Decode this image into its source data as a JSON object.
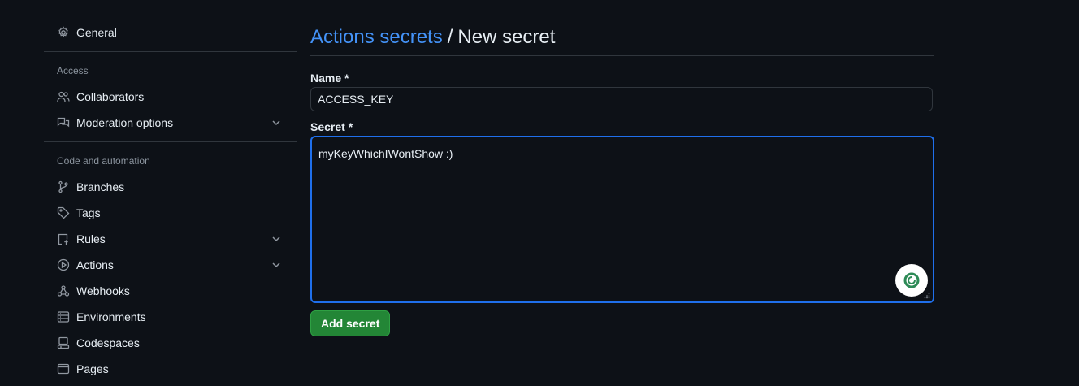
{
  "sidebar": {
    "general": {
      "label": "General",
      "icon": "gear-icon"
    },
    "access_heading": "Access",
    "access_items": [
      {
        "label": "Collaborators",
        "icon": "people-icon"
      },
      {
        "label": "Moderation options",
        "icon": "comment-discussion-icon",
        "expandable": true
      }
    ],
    "code_heading": "Code and automation",
    "code_items": [
      {
        "label": "Branches",
        "icon": "git-branch-icon"
      },
      {
        "label": "Tags",
        "icon": "tag-icon"
      },
      {
        "label": "Rules",
        "icon": "repo-push-icon",
        "expandable": true
      },
      {
        "label": "Actions",
        "icon": "play-icon",
        "expandable": true
      },
      {
        "label": "Webhooks",
        "icon": "webhook-icon"
      },
      {
        "label": "Environments",
        "icon": "server-icon"
      },
      {
        "label": "Codespaces",
        "icon": "codespaces-icon"
      },
      {
        "label": "Pages",
        "icon": "browser-icon"
      }
    ]
  },
  "main": {
    "breadcrumb_link": "Actions secrets",
    "breadcrumb_separator": "/",
    "page_title": "New secret",
    "name_label": "Name *",
    "name_value": "ACCESS_KEY",
    "secret_label": "Secret *",
    "secret_value": "myKeyWhichIWontShow :)",
    "add_button": "Add secret"
  },
  "colors": {
    "background": "#0d1117",
    "link": "#4493f8",
    "focus_border": "#1f6feb",
    "button": "#238636"
  }
}
